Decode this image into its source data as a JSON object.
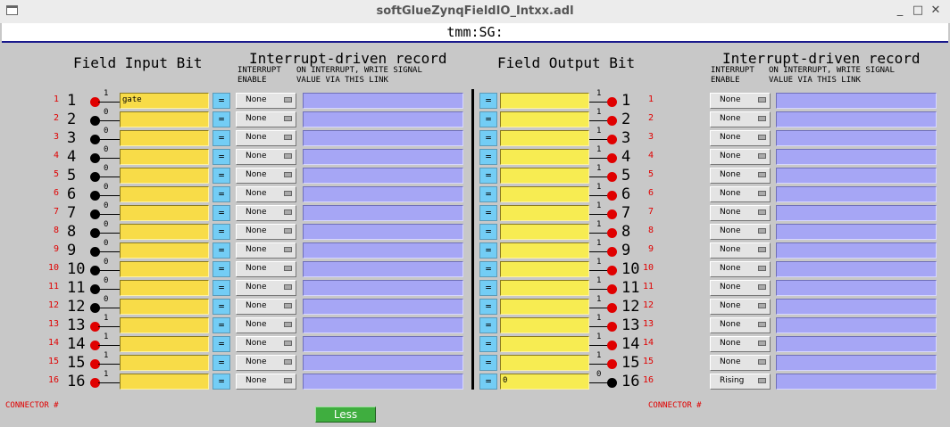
{
  "window": {
    "title": "softGlueZynqFieldIO_Intxx.adl",
    "minimize": "_",
    "maximize": "□",
    "close": "✕"
  },
  "header": {
    "title": "tmm:SG:"
  },
  "left": {
    "section_title": "Field Input Bit",
    "interrupt_title": "Interrupt-driven record",
    "col_enable_label": "INTERRUPT\nENABLE",
    "col_link_label": "ON INTERRUPT, WRITE SIGNAL\nVALUE VIA THIS LINK"
  },
  "right": {
    "section_title": "Field Output Bit",
    "interrupt_title": "Interrupt-driven record",
    "col_enable_label": "INTERRUPT\nENABLE",
    "col_link_label": "ON INTERRUPT, WRITE SIGNAL\nVALUE VIA THIS LINK"
  },
  "eq_label": "=",
  "inputs": [
    {
      "n": "1",
      "bit": "1",
      "signal": "gate",
      "enable": "None"
    },
    {
      "n": "2",
      "bit": "0",
      "signal": "",
      "enable": "None"
    },
    {
      "n": "3",
      "bit": "0",
      "signal": "",
      "enable": "None"
    },
    {
      "n": "4",
      "bit": "0",
      "signal": "",
      "enable": "None"
    },
    {
      "n": "5",
      "bit": "0",
      "signal": "",
      "enable": "None"
    },
    {
      "n": "6",
      "bit": "0",
      "signal": "",
      "enable": "None"
    },
    {
      "n": "7",
      "bit": "0",
      "signal": "",
      "enable": "None"
    },
    {
      "n": "8",
      "bit": "0",
      "signal": "",
      "enable": "None"
    },
    {
      "n": "9",
      "bit": "0",
      "signal": "",
      "enable": "None"
    },
    {
      "n": "10",
      "bit": "0",
      "signal": "",
      "enable": "None"
    },
    {
      "n": "11",
      "bit": "0",
      "signal": "",
      "enable": "None"
    },
    {
      "n": "12",
      "bit": "0",
      "signal": "",
      "enable": "None"
    },
    {
      "n": "13",
      "bit": "1",
      "signal": "",
      "enable": "None"
    },
    {
      "n": "14",
      "bit": "1",
      "signal": "",
      "enable": "None"
    },
    {
      "n": "15",
      "bit": "1",
      "signal": "",
      "enable": "None"
    },
    {
      "n": "16",
      "bit": "1",
      "signal": "",
      "enable": "None"
    }
  ],
  "outputs": [
    {
      "n": "1",
      "bit": "1",
      "signal": "",
      "enable": "None"
    },
    {
      "n": "2",
      "bit": "1",
      "signal": "",
      "enable": "None"
    },
    {
      "n": "3",
      "bit": "1",
      "signal": "",
      "enable": "None"
    },
    {
      "n": "4",
      "bit": "1",
      "signal": "",
      "enable": "None"
    },
    {
      "n": "5",
      "bit": "1",
      "signal": "",
      "enable": "None"
    },
    {
      "n": "6",
      "bit": "1",
      "signal": "",
      "enable": "None"
    },
    {
      "n": "7",
      "bit": "1",
      "signal": "",
      "enable": "None"
    },
    {
      "n": "8",
      "bit": "1",
      "signal": "",
      "enable": "None"
    },
    {
      "n": "9",
      "bit": "1",
      "signal": "",
      "enable": "None"
    },
    {
      "n": "10",
      "bit": "1",
      "signal": "",
      "enable": "None"
    },
    {
      "n": "11",
      "bit": "1",
      "signal": "",
      "enable": "None"
    },
    {
      "n": "12",
      "bit": "1",
      "signal": "",
      "enable": "None"
    },
    {
      "n": "13",
      "bit": "1",
      "signal": "",
      "enable": "None"
    },
    {
      "n": "14",
      "bit": "1",
      "signal": "",
      "enable": "None"
    },
    {
      "n": "15",
      "bit": "1",
      "signal": "",
      "enable": "None"
    },
    {
      "n": "16",
      "bit": "0",
      "signal": "0",
      "enable": "Rising"
    }
  ],
  "connector_label": "CONNECTOR #",
  "less_button": "Less",
  "colors": {
    "high": "#e00000",
    "low": "#000000",
    "signal_field": "#f8dc48",
    "link_field": "#a6a6f5",
    "eq_button": "#73cdf5",
    "less_button": "#3fae3f"
  }
}
